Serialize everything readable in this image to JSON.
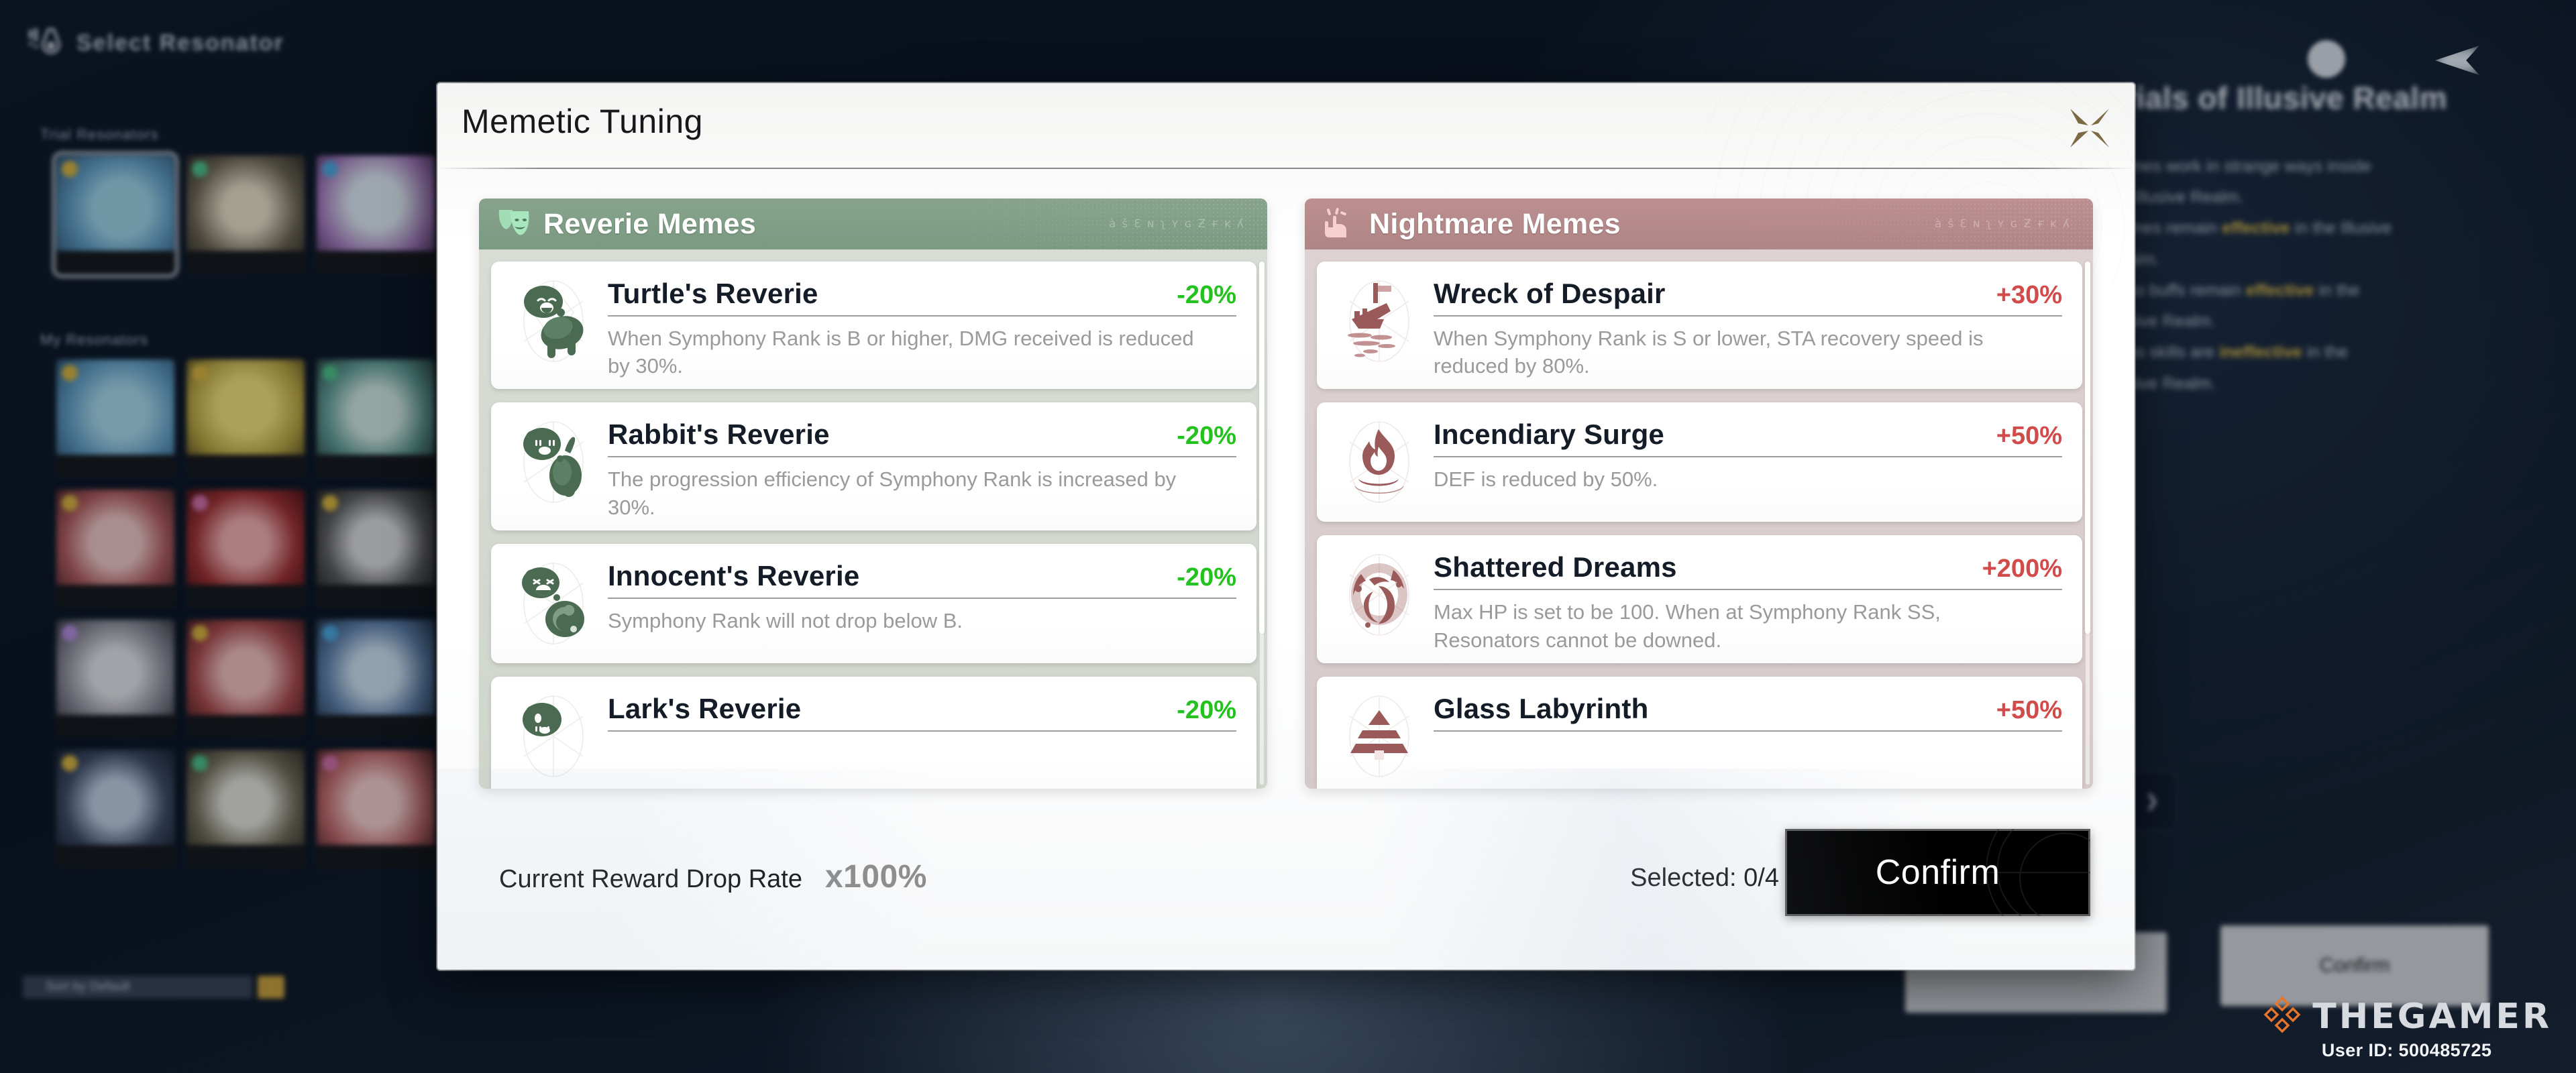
{
  "background": {
    "page_title": "Select Resonator",
    "page_title_icon": "resonator-icon",
    "section_trial": "Trial Resonators",
    "section_mine": "My Resonators",
    "sort_label": "Sort by Default",
    "info_title": "Trials of Illusive Realm",
    "info_lines": [
      "Memes work in strange ways inside",
      "the Illusive Realm.",
      "Memes remain effective in the Illusive",
      "Realm.",
      "Echo buffs remain effective in the",
      "Illusive Realm.",
      "Echo skills are ineffective in the",
      "Illusive Realm."
    ],
    "drop_rate_label": "Reward Drop Rate",
    "drop_rate_value": "x100%",
    "confirm_label": "Confirm"
  },
  "modal": {
    "title": "Memetic Tuning",
    "close_icon": "close-icon"
  },
  "reverie_panel": {
    "title": "Reverie Memes",
    "icon": "theater-masks-icon",
    "accent": "#7e9b85",
    "value_color": "#23c21f",
    "deco": "àšƐɴʅʏɢƵғĸʎ",
    "items": [
      {
        "icon": "turtle-icon",
        "name": "Turtle's Reverie",
        "value": "-20%",
        "desc": "When Symphony Rank is B or higher, DMG received is reduced by 30%."
      },
      {
        "icon": "rabbit-icon",
        "name": "Rabbit's Reverie",
        "value": "-20%",
        "desc": "The progression efficiency of Symphony Rank is increased by 30%."
      },
      {
        "icon": "innocent-icon",
        "name": "Innocent's Reverie",
        "value": "-20%",
        "desc": "Symphony Rank will not drop below B."
      },
      {
        "icon": "lark-icon",
        "name": "Lark's Reverie",
        "value": "-20%",
        "desc": ""
      }
    ]
  },
  "nightmare_panel": {
    "title": "Nightmare Memes",
    "icon": "hand-sparkle-icon",
    "accent": "#b08a8a",
    "value_color": "#d14b4b",
    "deco": "àšƐɴʅʏɢƵғĸʎ",
    "items": [
      {
        "icon": "shipwreck-icon",
        "name": "Wreck of Despair",
        "value": "+30%",
        "desc": "When Symphony Rank is S or lower, STA recovery speed is reduced by 80%."
      },
      {
        "icon": "flame-icon",
        "name": "Incendiary Surge",
        "value": "+50%",
        "desc": "DEF is reduced by 50%."
      },
      {
        "icon": "shatter-icon",
        "name": "Shattered Dreams",
        "value": "+200%",
        "desc": "Max HP is set to be 100. When at Symphony Rank SS, Resonators cannot be downed."
      },
      {
        "icon": "labyrinth-icon",
        "name": "Glass Labyrinth",
        "value": "+50%",
        "desc": ""
      }
    ]
  },
  "footer": {
    "drop_rate_label": "Current Reward Drop Rate",
    "drop_rate_value": "x100%",
    "selected_label": "Selected: 0/4",
    "confirm_label": "Confirm"
  },
  "watermark": {
    "brand": "THEGAMER",
    "user_id": "User ID: 500485725"
  }
}
